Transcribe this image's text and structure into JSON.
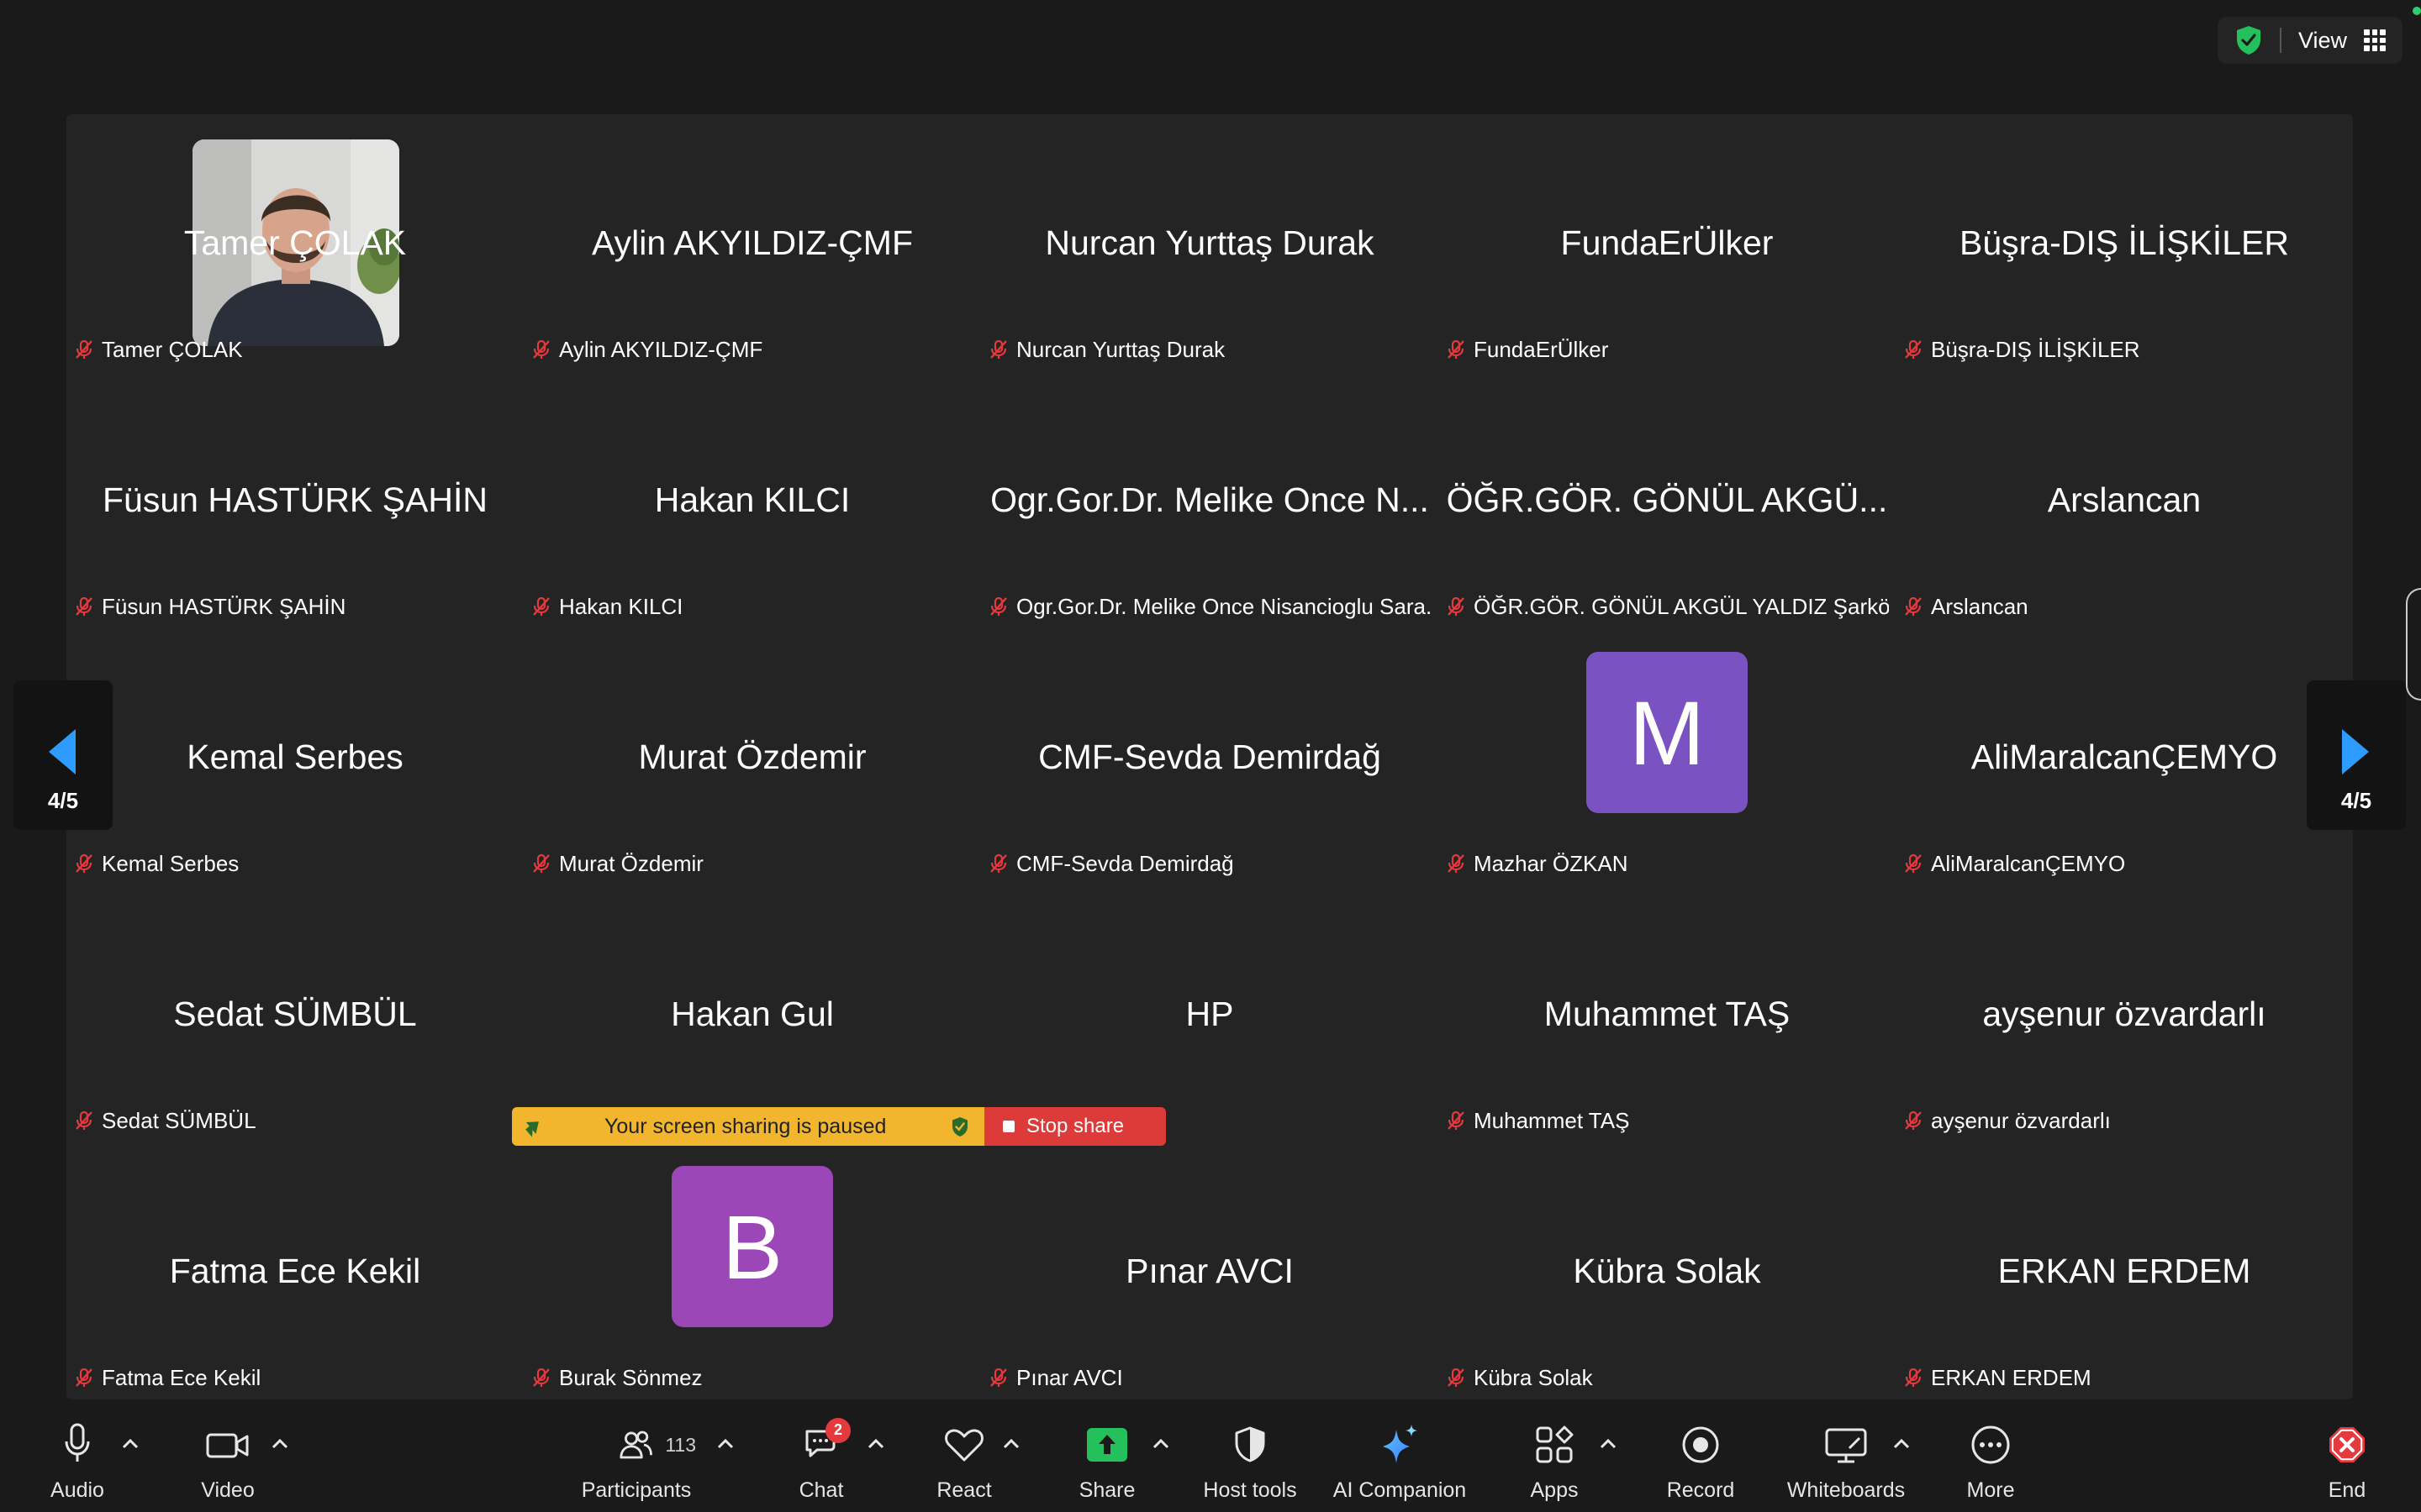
{
  "top_bar": {
    "view_label": "View"
  },
  "pagination": {
    "left": "4/5",
    "right": "4/5"
  },
  "tiles": [
    {
      "name": "Tamer ÇOLAK",
      "label": "Tamer ÇOLAK",
      "avatar": "photo"
    },
    {
      "name": "Aylin AKYILDIZ-ÇMF",
      "label": "Aylin AKYILDIZ-ÇMF"
    },
    {
      "name": "Nurcan Yurttaş Durak",
      "label": "Nurcan Yurttaş Durak"
    },
    {
      "name": "FundaErÜlker",
      "label": "FundaErÜlker"
    },
    {
      "name": "Büşra-DIŞ İLİŞKİLER",
      "label": "Büşra-DIŞ İLİŞKİLER"
    },
    {
      "name": "Füsun HASTÜRK ŞAHİN",
      "label": "Füsun HASTÜRK ŞAHİN"
    },
    {
      "name": "Hakan KILCI",
      "label": "Hakan KILCI"
    },
    {
      "name": "Ogr.Gor.Dr. Melike Once N...",
      "label": "Ogr.Gor.Dr. Melike Once Nisancioglu Sara..."
    },
    {
      "name": "ÖĞR.GÖR. GÖNÜL AKGÜ...",
      "label": "ÖĞR.GÖR. GÖNÜL AKGÜL YALDIZ Şarkö..."
    },
    {
      "name": "Arslancan",
      "label": "Arslancan"
    },
    {
      "name": "Kemal Serbes",
      "label": "Kemal Serbes"
    },
    {
      "name": "Murat Özdemir",
      "label": "Murat Özdemir"
    },
    {
      "name": "CMF-Sevda Demirdağ",
      "label": "CMF-Sevda Demirdağ"
    },
    {
      "name": "",
      "label": "Mazhar ÖZKAN",
      "avatar": "letter",
      "letter": "M",
      "color": "#7b52c2"
    },
    {
      "name": "AliMaralcanÇEMYO",
      "label": "AliMaralcanÇEMYO"
    },
    {
      "name": "Sedat SÜMBÜL",
      "label": "Sedat SÜMBÜL"
    },
    {
      "name": "Hakan Gul",
      "label": ""
    },
    {
      "name": "HP",
      "label": ""
    },
    {
      "name": "Muhammet TAŞ",
      "label": "Muhammet TAŞ"
    },
    {
      "name": "ayşenur özvardarlı",
      "label": "ayşenur özvardarlı"
    },
    {
      "name": "Fatma Ece Kekil",
      "label": "Fatma Ece Kekil"
    },
    {
      "name": "",
      "label": "Burak Sönmez",
      "avatar": "letter",
      "letter": "B",
      "color": "#9c47b8"
    },
    {
      "name": "Pınar AVCI",
      "label": "Pınar AVCI"
    },
    {
      "name": "Kübra Solak",
      "label": "Kübra Solak"
    },
    {
      "name": "ERKAN ERDEM",
      "label": "ERKAN ERDEM"
    }
  ],
  "share_bar": {
    "message": "Your screen sharing is paused",
    "stop_label": "Stop share"
  },
  "toolbar": {
    "audio": "Audio",
    "video": "Video",
    "participants": "Participants",
    "participants_count": "113",
    "chat": "Chat",
    "chat_badge": "2",
    "react": "React",
    "share": "Share",
    "host_tools": "Host tools",
    "ai_companion": "AI Companion",
    "apps": "Apps",
    "record": "Record",
    "whiteboards": "Whiteboards",
    "more": "More",
    "end": "End"
  },
  "colors": {
    "share_green": "#23c05b",
    "end_red": "#e5393d",
    "mute_red": "#e5393d",
    "nav_blue": "#2e9cff",
    "share_bar_yellow": "#f1b52e",
    "stop_red": "#dd3a3a"
  }
}
